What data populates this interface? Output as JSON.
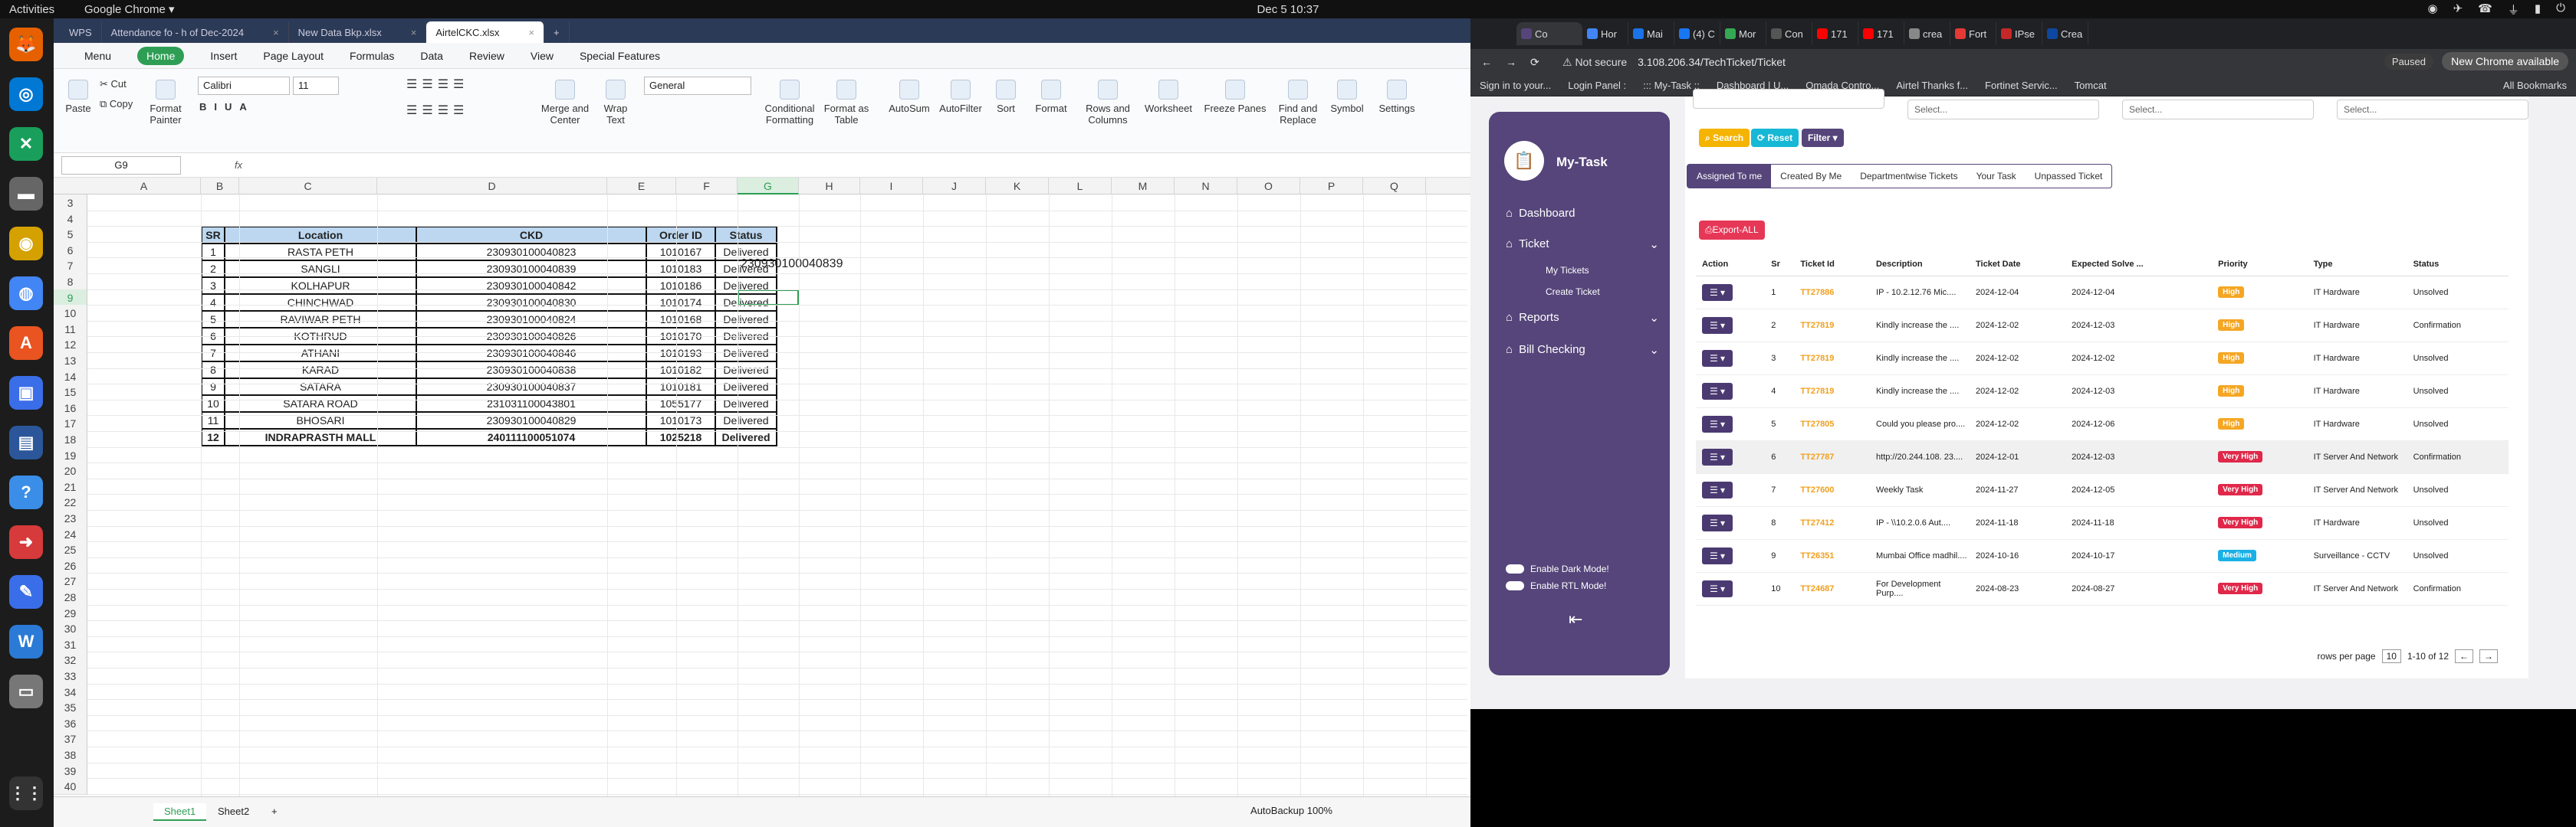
{
  "topbar": {
    "activities": "Activities",
    "app": "Google Chrome ▾",
    "clock": "Dec 5  10:37",
    "tray": [
      "◉",
      "✈",
      "☎",
      "⏚",
      "▮",
      "⏻"
    ]
  },
  "dock": [
    {
      "g": "🦊",
      "c": "#e66000"
    },
    {
      "g": "◎",
      "c": "#0078d4"
    },
    {
      "g": "✕",
      "c": "#199f5b"
    },
    {
      "g": "▬",
      "c": "#666"
    },
    {
      "g": "◉",
      "c": "#d4a100"
    },
    {
      "g": "◍",
      "c": "#4285f4"
    },
    {
      "g": "A",
      "c": "#e95420"
    },
    {
      "g": "▣",
      "c": "#3a6ee8"
    },
    {
      "g": "▤",
      "c": "#2b579a"
    },
    {
      "g": "?",
      "c": "#3a8ee8"
    },
    {
      "g": "➜",
      "c": "#d63a3a"
    },
    {
      "g": "✎",
      "c": "#3a6ee8"
    },
    {
      "g": "W",
      "c": "#2b7ad6"
    },
    {
      "g": "▭",
      "c": "#777"
    },
    {
      "g": "⋮⋮",
      "c": "#333"
    }
  ],
  "wps": {
    "tabs": [
      {
        "label": "WPS",
        "on": false
      },
      {
        "label": "Attendance fo - h of Dec-2024",
        "on": false
      },
      {
        "label": "New Data Bkp.xlsx",
        "on": false
      },
      {
        "label": "AirtelCKC.xlsx",
        "on": true
      }
    ],
    "menus": [
      "Menu",
      "Home",
      "Insert",
      "Page Layout",
      "Formulas",
      "Data",
      "Review",
      "View",
      "Special Features"
    ],
    "ribbon": {
      "paste": "Paste",
      "cut": "Cut",
      "copy": "Copy",
      "format_painter": "Format Painter",
      "font": "Calibri",
      "size": "11",
      "merge": "Merge and Center",
      "wrap": "Wrap Text",
      "numfmt": "General",
      "cond": "Conditional Formatting",
      "fmt_table": "Format as Table",
      "autosum": "AutoSum",
      "autofilter": "AutoFilter",
      "sort": "Sort",
      "format": "Format",
      "rows_cols": "Rows and Columns",
      "worksheet": "Worksheet",
      "freeze": "Freeze Panes",
      "find": "Find and Replace",
      "symbol": "Symbol",
      "settings": "Settings"
    },
    "namebox": "G9",
    "fx": "fx",
    "columns": [
      "A",
      "B",
      "C",
      "D",
      "E",
      "F",
      "G",
      "H",
      "I",
      "J",
      "K",
      "L",
      "M",
      "N",
      "O",
      "P",
      "Q"
    ],
    "rows": [
      "3",
      "4",
      "5",
      "6",
      "7",
      "8",
      "9",
      "10",
      "11",
      "12",
      "13",
      "14",
      "15",
      "16",
      "17",
      "18",
      "19",
      "20",
      "21",
      "22",
      "23",
      "24",
      "25",
      "26",
      "27",
      "28",
      "29",
      "30",
      "31",
      "32",
      "33",
      "34",
      "35",
      "36",
      "37",
      "38",
      "39",
      "40"
    ],
    "table": {
      "headers": [
        "SR",
        "Location",
        "CKD",
        "Order ID",
        "Status"
      ],
      "rows": [
        [
          "1",
          "RASTA PETH",
          "230930100040823",
          "1010167",
          "Delivered"
        ],
        [
          "2",
          "SANGLI",
          "230930100040839",
          "1010183",
          "Delivered"
        ],
        [
          "3",
          "KOLHAPUR",
          "230930100040842",
          "1010186",
          "Delivered"
        ],
        [
          "4",
          "CHINCHWAD",
          "230930100040830",
          "1010174",
          "Delivered"
        ],
        [
          "5",
          "RAVIWAR PETH",
          "230930100040824",
          "1010168",
          "Delivered"
        ],
        [
          "6",
          "KOTHRUD",
          "230930100040826",
          "1010170",
          "Delivered"
        ],
        [
          "7",
          "ATHANI",
          "230930100040846",
          "1010193",
          "Delivered"
        ],
        [
          "8",
          "KARAD",
          "230930100040838",
          "1010182",
          "Delivered"
        ],
        [
          "9",
          "SATARA",
          "230930100040837",
          "1010181",
          "Delivered"
        ],
        [
          "10",
          "SATARA ROAD",
          "231031100043801",
          "1055177",
          "Delivered"
        ],
        [
          "11",
          "BHOSARI",
          "230930100040829",
          "1010173",
          "Delivered"
        ],
        [
          "12",
          "INDRAPRASTH MALL",
          "240111100051074",
          "1025218",
          "Delivered"
        ]
      ]
    },
    "g7_text": "230930100040839",
    "sheets": [
      "Sheet1",
      "Sheet2",
      "+"
    ],
    "status": {
      "autobackup": "AutoBackup",
      "zoom": "100%"
    }
  },
  "chrome": {
    "tabs": [
      "Co",
      "Hor",
      "Mai",
      "(4) C",
      "Mor",
      "Con",
      "171",
      "171",
      "crea",
      "Fort",
      "IPse",
      "Crea"
    ],
    "tab_colors": [
      "#55457a",
      "#4285f4",
      "#1a73e8",
      "#1877f2",
      "#34a853",
      "#555",
      "#ff0000",
      "#ff0000",
      "#888",
      "#e53935",
      "#c62828",
      "#0d47a1"
    ],
    "warn": "⚠ Not secure",
    "url": "3.108.206.34/TechTicket/Ticket",
    "paused": "Paused",
    "new_chrome": "New Chrome available",
    "bookmarks": [
      "Sign in to your...",
      "Login Panel :",
      "::: My-Task ::",
      "Dashboard | U...",
      "Omada Contro...",
      "Airtel Thanks f...",
      "Fortinet Servic...",
      "Tomcat",
      "All Bookmarks"
    ],
    "app": {
      "brand": "My-Task",
      "nav": [
        "Dashboard",
        "Ticket",
        "Reports",
        "Bill Checking"
      ],
      "sub": [
        "My Tickets",
        "Create Ticket"
      ],
      "toggles": [
        "Enable Dark Mode!",
        "Enable RTL Mode!"
      ],
      "back": "⇤",
      "selects": [
        "Select...",
        "Select...",
        "Select..."
      ],
      "search": "Search",
      "reset": "Reset",
      "filter": "Filter",
      "tabs": [
        "Assigned To me",
        "Created By Me",
        "Departmentwise Tickets",
        "Your Task",
        "Unpassed Ticket"
      ],
      "export": "Export-ALL",
      "headers": [
        "Action",
        "Sr",
        "Ticket Id",
        "Description",
        "Ticket Date",
        "Expected Solve ...",
        "Priority",
        "Type",
        "Status"
      ],
      "rows": [
        [
          "1",
          "TT27886",
          "IP - 10.2.12.76 Mic....",
          "2024-12-04",
          "2024-12-04",
          "High",
          "#f5a623",
          "IT Hardware",
          "Unsolved"
        ],
        [
          "2",
          "TT27819",
          "Kindly increase the ....",
          "2024-12-02",
          "2024-12-03",
          "High",
          "#f5a623",
          "IT Hardware",
          "Confirmation"
        ],
        [
          "3",
          "TT27819",
          "Kindly increase the ....",
          "2024-12-02",
          "2024-12-02",
          "High",
          "#f5a623",
          "IT Hardware",
          "Unsolved"
        ],
        [
          "4",
          "TT27819",
          "Kindly increase the ....",
          "2024-12-02",
          "2024-12-03",
          "High",
          "#f5a623",
          "IT Hardware",
          "Unsolved"
        ],
        [
          "5",
          "TT27805",
          "Could you please pro....",
          "2024-12-02",
          "2024-12-06",
          "High",
          "#f5a623",
          "IT Hardware",
          "Unsolved"
        ],
        [
          "6",
          "TT27787",
          "http://20.244.108. 23....",
          "2024-12-01",
          "2024-12-03",
          "Very High",
          "#e0284a",
          "IT Server And Network",
          "Confirmation"
        ],
        [
          "7",
          "TT27600",
          "Weekly Task",
          "2024-11-27",
          "2024-12-05",
          "Very High",
          "#e0284a",
          "IT Server And Network",
          "Unsolved"
        ],
        [
          "8",
          "TT27412",
          "IP - \\\\10.2.0.6 Aut....",
          "2024-11-18",
          "2024-11-18",
          "Very High",
          "#e0284a",
          "IT Hardware",
          "Unsolved"
        ],
        [
          "9",
          "TT26351",
          "Mumbai Office madhil....",
          "2024-10-16",
          "2024-10-17",
          "Medium",
          "#1ab0e6",
          "Surveillance - CCTV",
          "Unsolved"
        ],
        [
          "10",
          "TT24687",
          "For Development Purp....",
          "2024-08-23",
          "2024-08-27",
          "Very High",
          "#e0284a",
          "IT Server And Network",
          "Confirmation"
        ]
      ],
      "pager": {
        "label": "rows per page",
        "size": "10",
        "range": "1-10 of 12",
        "prev": "←",
        "next": "→"
      }
    }
  }
}
